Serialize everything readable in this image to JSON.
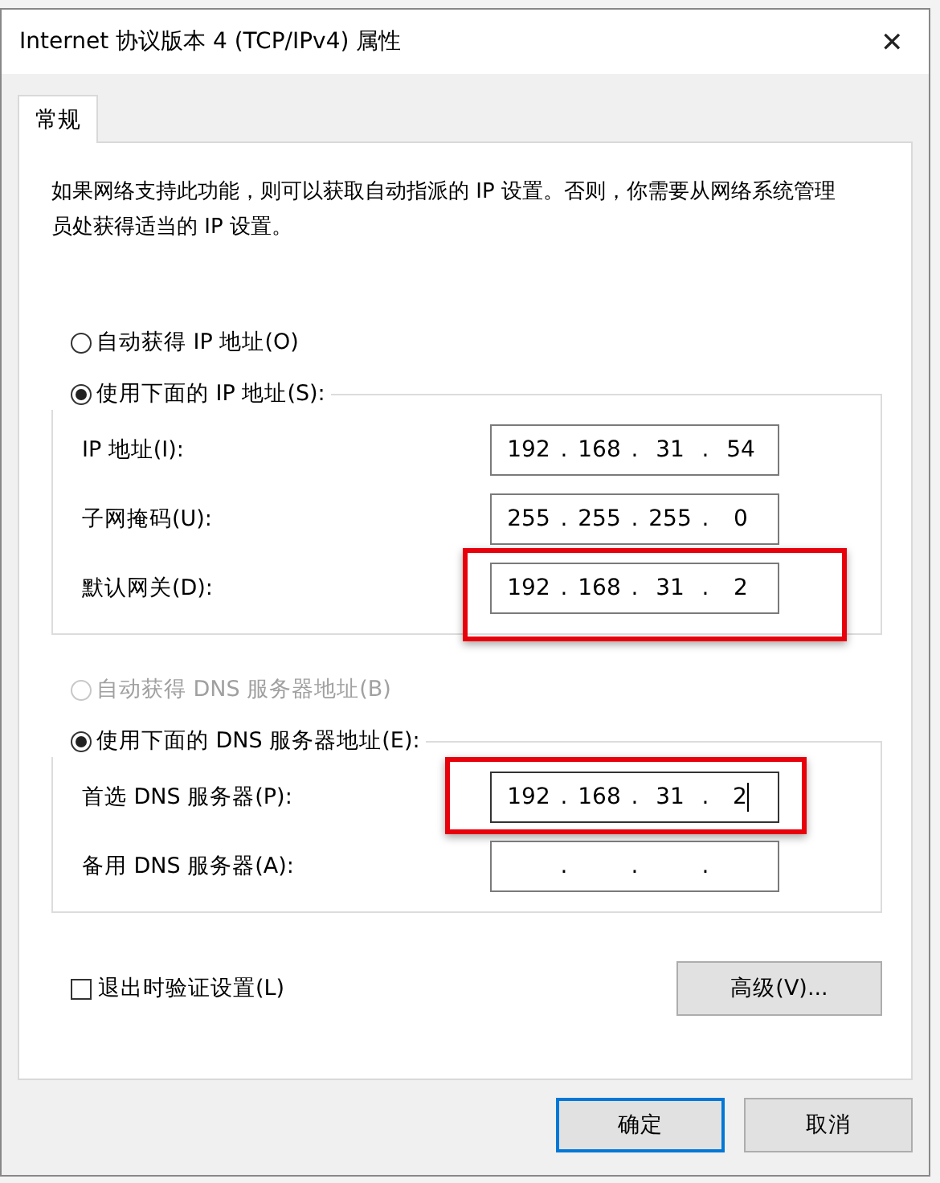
{
  "window": {
    "title": "Internet 协议版本 4 (TCP/IPv4) 属性",
    "close": "✕"
  },
  "tabs": [
    {
      "label": "常规",
      "selected": true
    }
  ],
  "description": "如果网络支持此功能，则可以获取自动指派的 IP 设置。否则，你需要从网络系统管理员处获得适当的 IP 设置。",
  "octet_separator": ".",
  "ip_section": {
    "auto_option": {
      "label": "自动获得 IP 地址(O)",
      "selected": false,
      "disabled": false
    },
    "manual_option": {
      "label": "使用下面的 IP 地址(S):",
      "selected": true,
      "disabled": false
    },
    "fields": [
      {
        "label": "IP 地址(I):",
        "octets": [
          "192",
          "168",
          "31",
          "54"
        ],
        "highlighted": false,
        "focused": false
      },
      {
        "label": "子网掩码(U):",
        "octets": [
          "255",
          "255",
          "255",
          "0"
        ],
        "highlighted": false,
        "focused": false
      },
      {
        "label": "默认网关(D):",
        "octets": [
          "192",
          "168",
          "31",
          "2"
        ],
        "highlighted": true,
        "focused": false
      }
    ]
  },
  "dns_section": {
    "auto_option": {
      "label": "自动获得 DNS 服务器地址(B)",
      "selected": false,
      "disabled": true
    },
    "manual_option": {
      "label": "使用下面的 DNS 服务器地址(E):",
      "selected": true,
      "disabled": false
    },
    "fields": [
      {
        "label": "首选 DNS 服务器(P):",
        "octets": [
          "192",
          "168",
          "31",
          "2"
        ],
        "highlighted": true,
        "focused": true
      },
      {
        "label": "备用 DNS 服务器(A):",
        "highlighted": false,
        "focused": false
      }
    ]
  },
  "validate_checkbox": {
    "label": "退出时验证设置(L)",
    "checked": false
  },
  "advanced_button": "高级(V)...",
  "buttons": [
    {
      "label": "确定",
      "default": true
    },
    {
      "label": "取消",
      "default": false
    }
  ]
}
